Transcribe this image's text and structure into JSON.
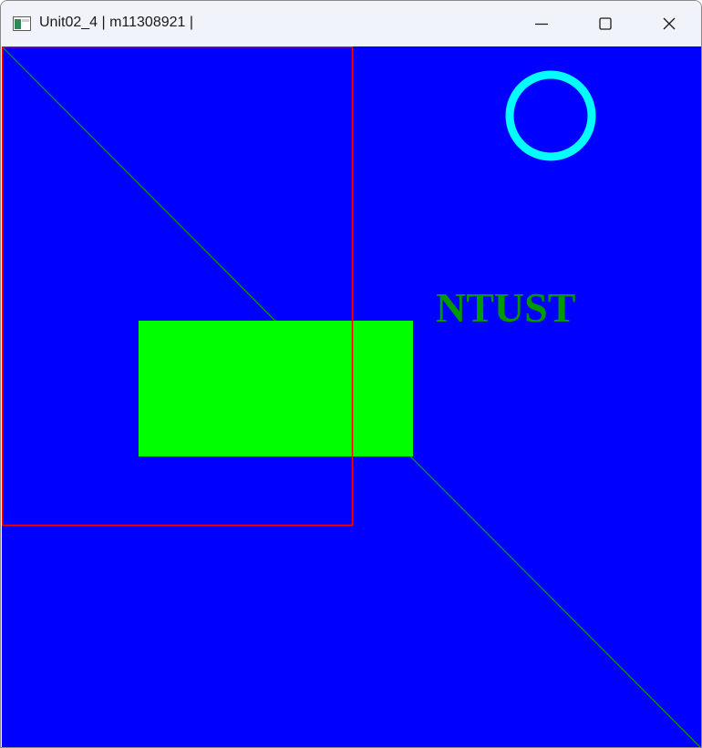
{
  "window": {
    "title": "Unit02_4 | m11308921 |",
    "icon": "console-app-icon",
    "controls": {
      "minimize": "minimize-icon",
      "maximize": "maximize-icon",
      "close": "close-icon"
    }
  },
  "canvas": {
    "background_color": "#0000ff",
    "text": "NTUST",
    "text_color": "#009900",
    "rect_fill_color": "#00ff00",
    "rect_outline_color": "#ff0000",
    "diagonal_line_color": "#00a000",
    "circle_color": "#00ffff"
  }
}
